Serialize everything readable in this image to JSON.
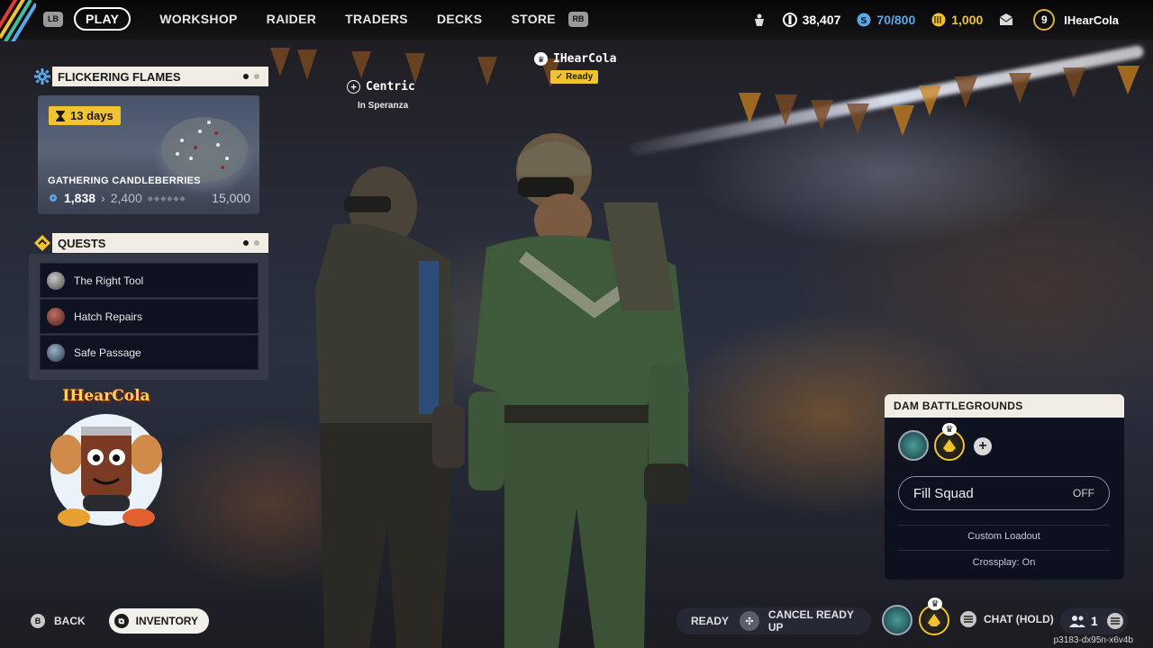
{
  "topbar": {
    "lb": "LB",
    "rb": "RB",
    "nav": [
      "PLAY",
      "WORKSHOP",
      "RAIDER",
      "TRADERS",
      "DECKS",
      "STORE"
    ],
    "coins": "38,407",
    "tokens": "70/800",
    "cred": "1,000",
    "level": "9",
    "username": "IHearCola"
  },
  "event": {
    "title": "FLICKERING FLAMES",
    "days": "13  days",
    "name": "GATHERING CANDLEBERRIES",
    "current": "1,838",
    "next": "2,400",
    "max": "15,000"
  },
  "quests": {
    "title": "QUESTS",
    "items": [
      "The Right Tool",
      "Hatch Repairs",
      "Safe Passage"
    ]
  },
  "avatar": {
    "name": "IHearCola"
  },
  "players": {
    "leader": {
      "name": "IHearCola",
      "status": "Ready"
    },
    "other": {
      "name": "Centric",
      "location": "In Speranza"
    }
  },
  "squad": {
    "map": "DAM BATTLEGROUNDS",
    "fill_label": "Fill Squad",
    "fill_value": "OFF",
    "loadout": "Custom Loadout",
    "crossplay": "Crossplay: On"
  },
  "bottom": {
    "back_key": "B",
    "back": "BACK",
    "inventory": "INVENTORY",
    "ready": "READY",
    "cancel": "CANCEL READY UP",
    "chat": "CHAT (HOLD)",
    "party_count": "1",
    "session_id": "p3183-dx95n-x6v4b"
  },
  "colors": {
    "accent_gold": "#f0c330",
    "accent_blue": "#5aa8e8",
    "panel_head": "#f2ede4"
  }
}
